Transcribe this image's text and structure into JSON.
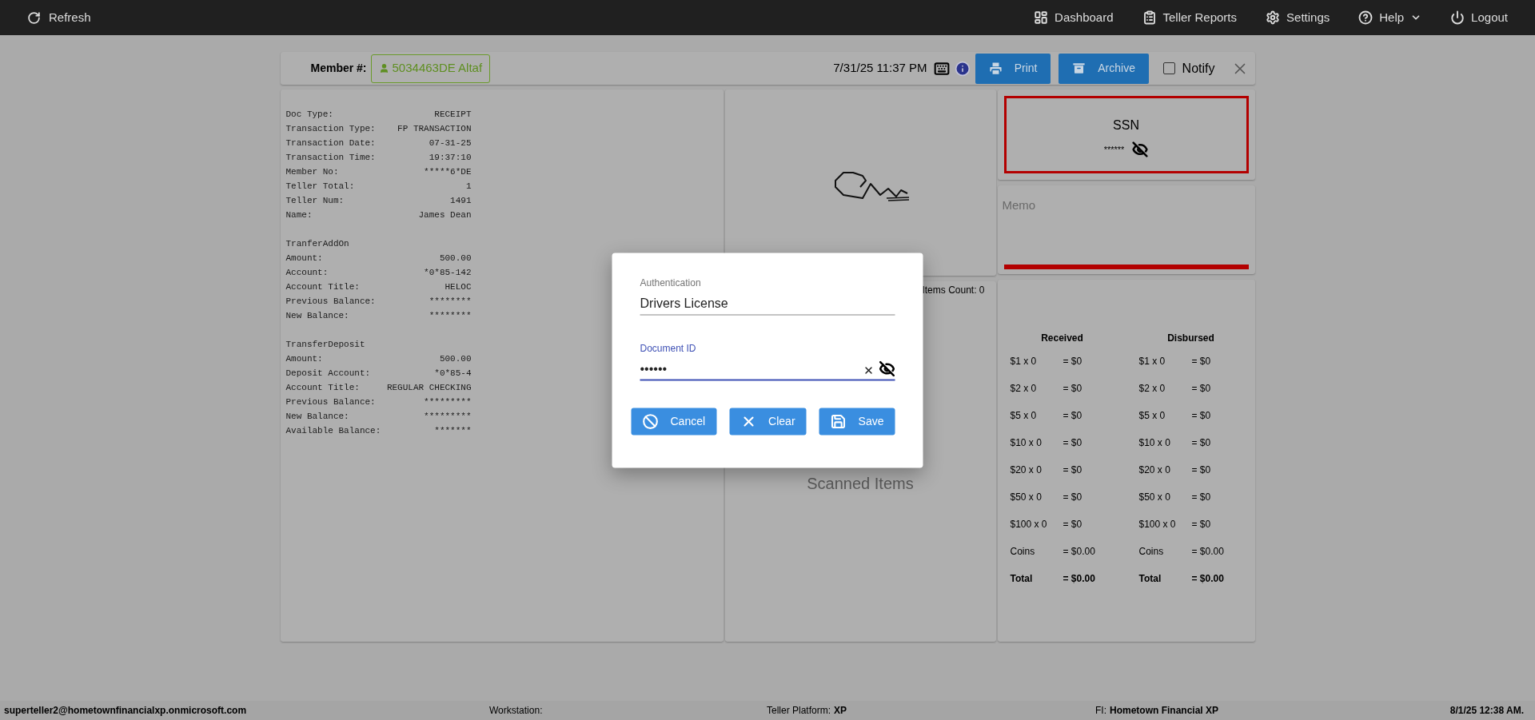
{
  "topbar": {
    "refresh": "Refresh",
    "nav": [
      {
        "label": "Dashboard",
        "dropdown": false
      },
      {
        "label": "Teller Reports",
        "dropdown": false
      },
      {
        "label": "Settings",
        "dropdown": false
      },
      {
        "label": "Help",
        "dropdown": true
      },
      {
        "label": "Logout",
        "dropdown": false
      }
    ]
  },
  "header": {
    "member_label": "Member #:",
    "member": "5034463DE Altaf",
    "datetime": "7/31/25 11:37 PM",
    "print": "Print",
    "archive": "Archive",
    "notify": {
      "label": "Notify",
      "checked": false
    }
  },
  "receipt": [
    {
      "lines": [
        {
          "label": "Doc Type:",
          "value": "RECEIPT"
        },
        {
          "label": "Transaction Type:",
          "value": "FP TRANSACTION"
        },
        {
          "label": "Transaction Date:",
          "value": "07-31-25"
        },
        {
          "label": "Transaction Time:",
          "value": "19:37:10"
        },
        {
          "label": "Member No:",
          "value": "*****6*DE"
        },
        {
          "label": "Teller Total:",
          "value": "1"
        },
        {
          "label": "Teller Num:",
          "value": "1491"
        },
        {
          "label": "Name:",
          "value": "James Dean"
        }
      ]
    },
    {
      "heading": "TranferAddOn",
      "lines": [
        {
          "label": "Amount:",
          "value": "500.00"
        },
        {
          "label": "Account:",
          "value": "*0*85-142"
        },
        {
          "label": "Account Title:",
          "value": "HELOC"
        },
        {
          "label": "Previous Balance:",
          "value": "********"
        },
        {
          "label": "New Balance:",
          "value": "********"
        }
      ]
    },
    {
      "heading": "TransferDeposit",
      "lines": [
        {
          "label": "Amount:",
          "value": "500.00"
        },
        {
          "label": "Deposit Account:",
          "value": "*0*85-4"
        },
        {
          "label": "Account Title:",
          "value": "REGULAR CHECKING"
        },
        {
          "label": "Previous Balance:",
          "value": "*********"
        },
        {
          "label": "New Balance:",
          "value": "*********"
        },
        {
          "label": "Available Balance:",
          "value": "*******"
        }
      ]
    }
  ],
  "items": {
    "count": "Items Count: 0",
    "empty_text": "Scanned Items"
  },
  "ssn": {
    "label": "SSN",
    "value": "******"
  },
  "memo": {
    "placeholder": "Memo"
  },
  "cash": [
    {
      "heading": "Received",
      "rows": [
        {
          "kind": "line",
          "denomination": "$1 x 0",
          "amount": "= $0"
        },
        {
          "kind": "line",
          "denomination": "$2 x 0",
          "amount": "= $0"
        },
        {
          "kind": "line",
          "denomination": "$5 x 0",
          "amount": "= $0"
        },
        {
          "kind": "line",
          "denomination": "$10 x 0",
          "amount": "= $0"
        },
        {
          "kind": "line",
          "denomination": "$20 x 0",
          "amount": "= $0"
        },
        {
          "kind": "line",
          "denomination": "$50 x 0",
          "amount": "= $0"
        },
        {
          "kind": "line",
          "denomination": "$100 x 0",
          "amount": "= $0"
        },
        {
          "kind": "line",
          "denomination": "Coins",
          "amount": "= $0.00"
        },
        {
          "kind": "total",
          "denomination": "Total",
          "amount": "= $0.00"
        }
      ]
    },
    {
      "heading": "Disbursed",
      "rows": [
        {
          "kind": "line",
          "denomination": "$1 x 0",
          "amount": "= $0"
        },
        {
          "kind": "line",
          "denomination": "$2 x 0",
          "amount": "= $0"
        },
        {
          "kind": "line",
          "denomination": "$5 x 0",
          "amount": "= $0"
        },
        {
          "kind": "line",
          "denomination": "$10 x 0",
          "amount": "= $0"
        },
        {
          "kind": "line",
          "denomination": "$20 x 0",
          "amount": "= $0"
        },
        {
          "kind": "line",
          "denomination": "$50 x 0",
          "amount": "= $0"
        },
        {
          "kind": "line",
          "denomination": "$100 x 0",
          "amount": "= $0"
        },
        {
          "kind": "line",
          "denomination": "Coins",
          "amount": "= $0.00"
        },
        {
          "kind": "total",
          "denomination": "Total",
          "amount": "= $0.00"
        }
      ]
    }
  ],
  "dialog": {
    "fields": [
      {
        "kind": "text",
        "label": "Authentication",
        "value": "Drivers License",
        "focused": false
      },
      {
        "kind": "secret",
        "label": "Document ID",
        "value": "••••••",
        "focused": true
      }
    ],
    "buttons": [
      "Cancel",
      "Clear",
      "Save"
    ]
  },
  "status_bar": {
    "user": "superteller2@hometownfinancialxp.onmicrosoft.com",
    "items": [
      {
        "label": "Workstation:"
      },
      {
        "label": "Teller Platform:",
        "value": "XP"
      },
      {
        "label": "FI:",
        "value": "Hometown Financial XP"
      }
    ],
    "datetime": "8/1/25 12:38 AM."
  }
}
